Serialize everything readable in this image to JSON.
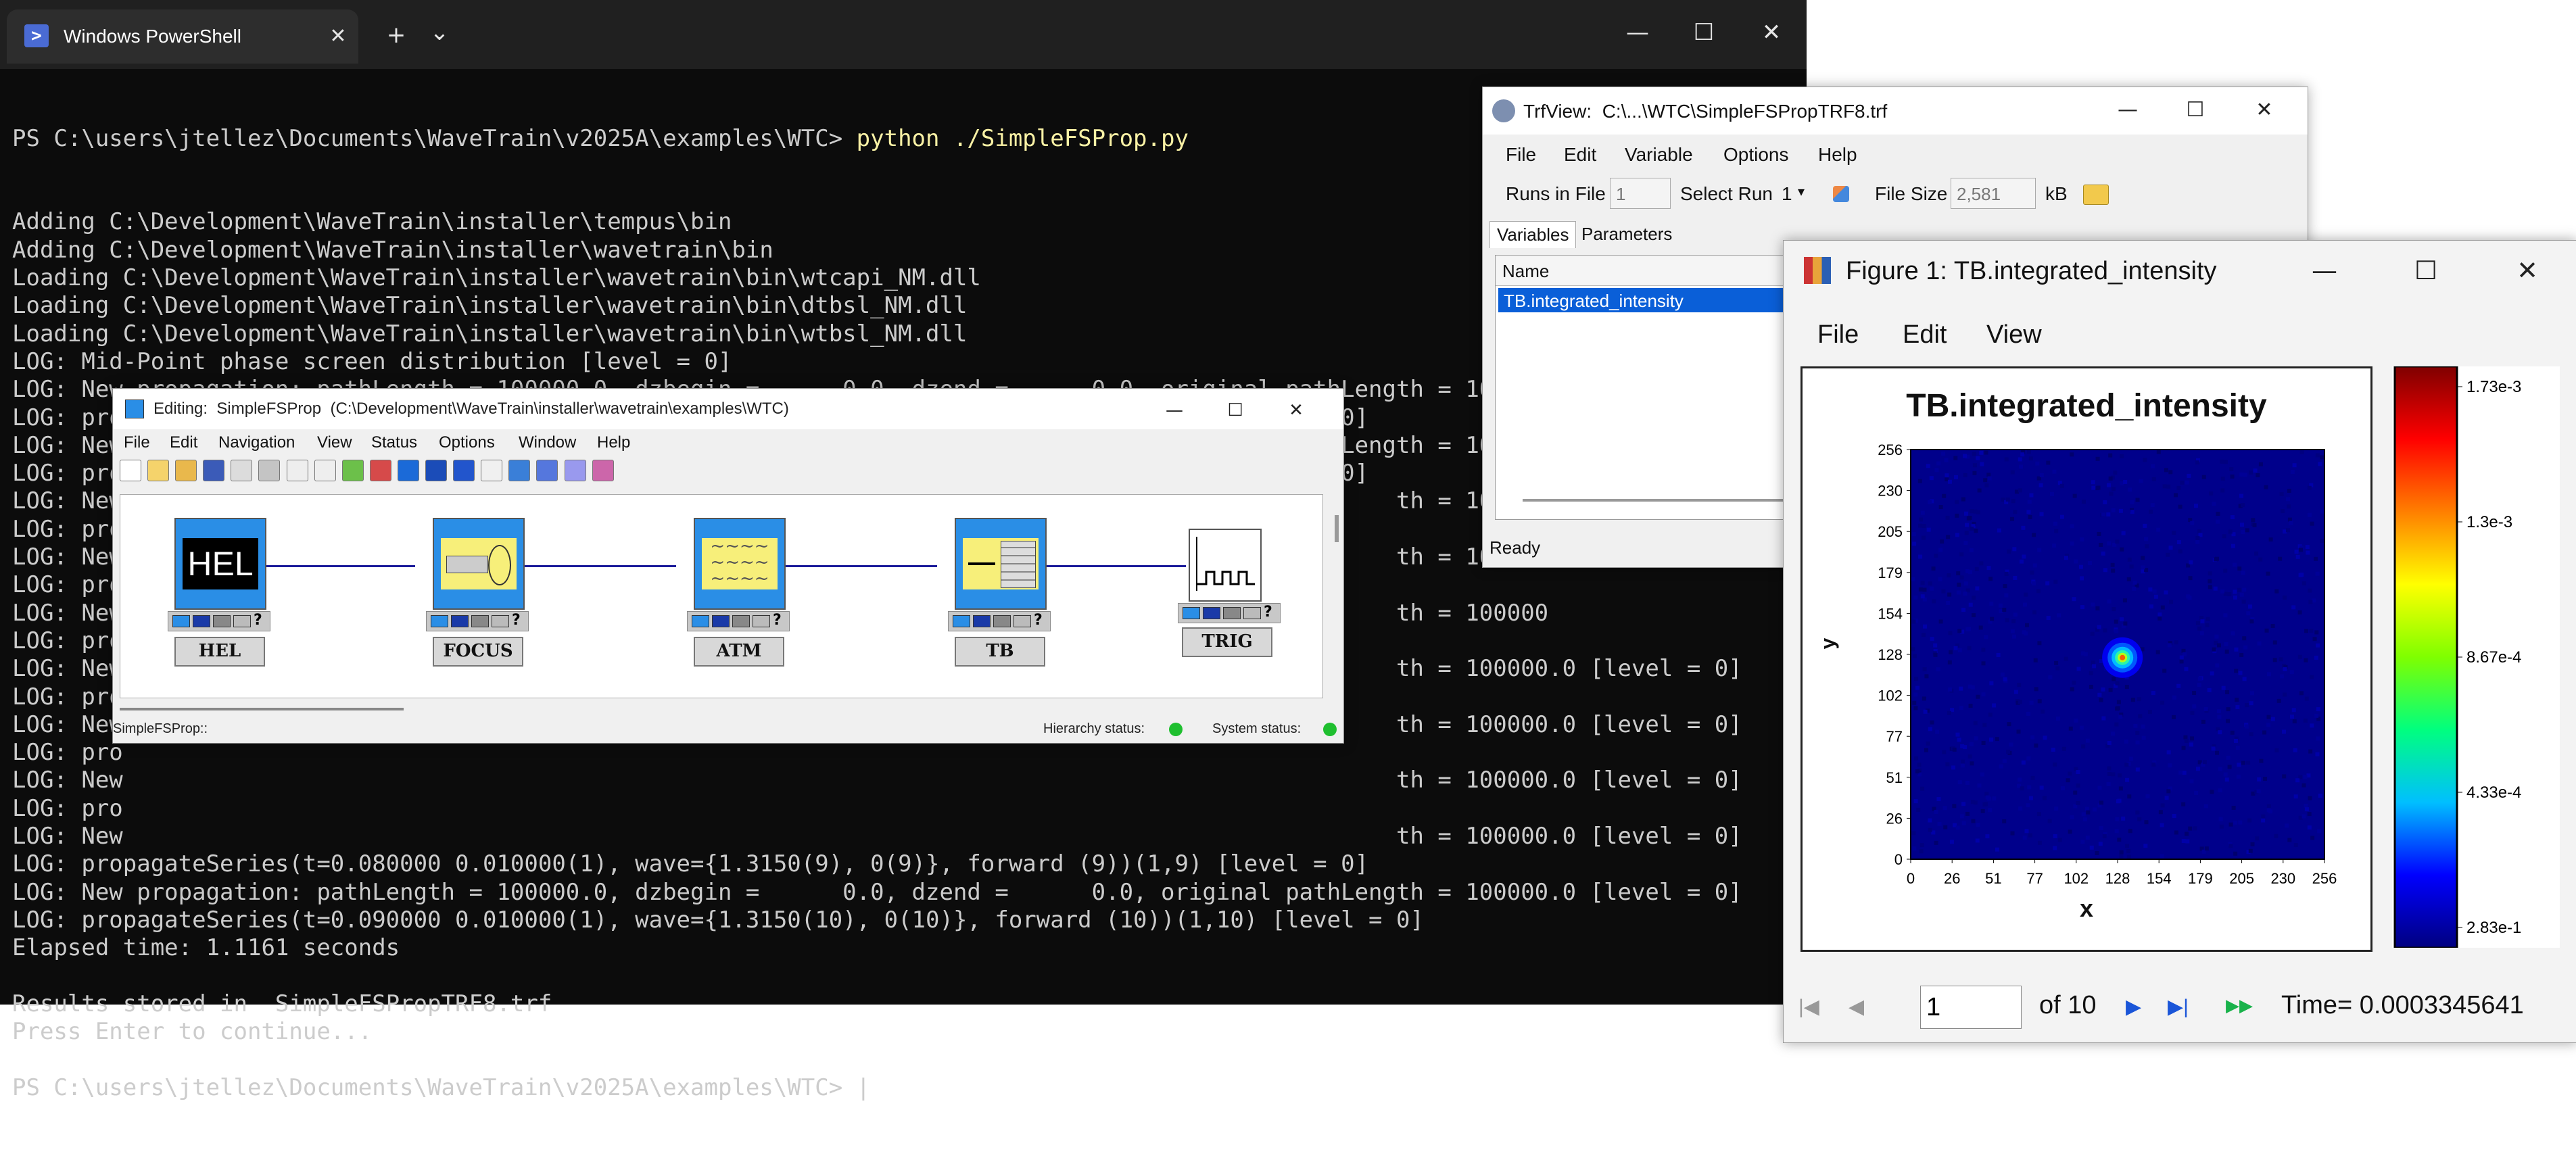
{
  "powershell": {
    "tab_title": "Windows PowerShell",
    "ps_icon_glyph": ">",
    "new_tab": "+",
    "tab_dropdown": "⌄",
    "win_min": "—",
    "win_max": "☐",
    "win_close": "✕",
    "command_prompt": "PS C:\\users\\jtellez\\Documents\\WaveTrain\\v2025A\\examples\\WTC> ",
    "command_text": "python ./SimpleFSProp.py",
    "lines": [
      "Adding C:\\Development\\WaveTrain\\installer\\tempus\\bin",
      "Adding C:\\Development\\WaveTrain\\installer\\wavetrain\\bin",
      "Loading C:\\Development\\WaveTrain\\installer\\wavetrain\\bin\\wtcapi_NM.dll",
      "Loading C:\\Development\\WaveTrain\\installer\\wavetrain\\bin\\dtbsl_NM.dll",
      "Loading C:\\Development\\WaveTrain\\installer\\wavetrain\\bin\\wtbsl_NM.dll",
      "LOG: Mid-Point phase screen distribution [level = 0]",
      "LOG: New propagation: pathLength = 100000.0, dzbegin =      0.0, dzend =      0.0, original pathLength = 100000",
      "LOG: propagateSeries(t=0.000000 1.000000(1), wave={1.3150(1), 0(1)}, forward (1))(1,1) [level = 0]",
      "LOG: New propagation: pathLength = 100000.0, dzbegin =      0.0, dzend =      0.0, original pathLength = 100000",
      "LOG: propagateSeries(t=0.010000 0.010000(1), wave={1.3150(2), 0(2)}, forward (2))(1,2) [level = 0]",
      "LOG: New                                                                                            th = 100000",
      "LOG: pro",
      "LOG: New                                                                                            th = 100000",
      "LOG: pro",
      "LOG: New                                                                                            th = 100000",
      "LOG: pro",
      "LOG: New                                                                                            th = 100000.0 [level = 0]",
      "LOG: pro",
      "LOG: New                                                                                            th = 100000.0 [level = 0]",
      "LOG: pro",
      "LOG: New                                                                                            th = 100000.0 [level = 0]",
      "LOG: pro",
      "LOG: New                                                                                            th = 100000.0 [level = 0]",
      "LOG: propagateSeries(t=0.080000 0.010000(1), wave={1.3150(9), 0(9)}, forward (9))(1,9) [level = 0]",
      "LOG: New propagation: pathLength = 100000.0, dzbegin =      0.0, dzend =      0.0, original pathLength = 100000.0 [level = 0]",
      "LOG: propagateSeries(t=0.090000 0.010000(1), wave={1.3150(10), 0(10)}, forward (10))(1,10) [level = 0]",
      "Elapsed time: 1.1161 seconds",
      "",
      "Results stored in  SimpleFSPropTRF8.trf",
      "Press Enter to continue...",
      "",
      "PS C:\\users\\jtellez\\Documents\\WaveTrain\\v2025A\\examples\\WTC> |"
    ]
  },
  "editor": {
    "title": "Editing:  SimpleFSProp  (C:\\Development\\WaveTrain\\installer\\wavetrain\\examples\\WTC)",
    "win_min": "—",
    "win_max": "☐",
    "win_close": "✕",
    "menu": [
      "File",
      "Edit",
      "Navigation",
      "View",
      "Status",
      "Options",
      "Window",
      "Help"
    ],
    "blocks": [
      {
        "label": "HEL",
        "icon_text": "HEL",
        "color": "#2a8ee6"
      },
      {
        "label": "FOCUS",
        "color": "#2a8ee6"
      },
      {
        "label": "ATM",
        "color": "#2a8ee6"
      },
      {
        "label": "TB",
        "color": "#2a8ee6"
      },
      {
        "label": "TRIG",
        "color": "#ffffff"
      }
    ],
    "port_help": "?",
    "status_path": "SimpleFSProp::",
    "hierarchy_status_label": "Hierarchy status:",
    "system_status_label": "System status:",
    "status_color": "#1fbf2f"
  },
  "trfview": {
    "title": "TrfView:  C:\\...\\WTC\\SimpleFSPropTRF8.trf",
    "win_min": "—",
    "win_max": "☐",
    "win_close": "✕",
    "menu": [
      "File",
      "Edit",
      "Variable",
      "Options",
      "Help"
    ],
    "runs_in_file_label": "Runs in File",
    "runs_in_file_value": "1",
    "select_run_label": "Select Run",
    "select_run_value": "1",
    "file_size_label": "File Size",
    "file_size_value": "2,581",
    "file_size_unit": "kB",
    "tabs": [
      "Variables",
      "Parameters"
    ],
    "list_header": "Name",
    "list_items": [
      "TB.integrated_intensity"
    ],
    "status": "Ready"
  },
  "figure": {
    "title": "Figure 1: TB.integrated_intensity",
    "win_min": "—",
    "win_max": "☐",
    "win_close": "✕",
    "menu": [
      "File",
      "Edit",
      "View"
    ],
    "frame_value": "1",
    "frame_of": "of 10",
    "time_text": "Time= 0.0003345641",
    "nav_first": "|◀",
    "nav_prev": "◀",
    "nav_next": "▶",
    "nav_last": "▶|",
    "nav_play": "▶▶"
  },
  "chart_data": {
    "type": "heatmap",
    "title": "TB.integrated_intensity",
    "xlabel": "x",
    "ylabel": "y",
    "x_ticks": [
      "0",
      "26",
      "51",
      "77",
      "102",
      "128",
      "154",
      "179",
      "205",
      "230",
      "256"
    ],
    "y_ticks": [
      "256",
      "230",
      "205",
      "179",
      "154",
      "128",
      "102",
      "77",
      "51",
      "26",
      "0"
    ],
    "xlim": [
      0,
      256
    ],
    "ylim": [
      0,
      256
    ],
    "colorbar_ticks": [
      "1.73e-3",
      "1.3e-3",
      "8.67e-4",
      "4.33e-4",
      "2.83e-1"
    ],
    "colorbar_max": 0.00173,
    "colormap": [
      "#00007f",
      "#0000ff",
      "#00bfff",
      "#00ff7f",
      "#7fff00",
      "#ffff00",
      "#ff7f00",
      "#ff0000",
      "#7f0000"
    ],
    "background_color": "#00008b",
    "peak": {
      "x": 131,
      "y": 126,
      "value": 0.00173
    }
  }
}
